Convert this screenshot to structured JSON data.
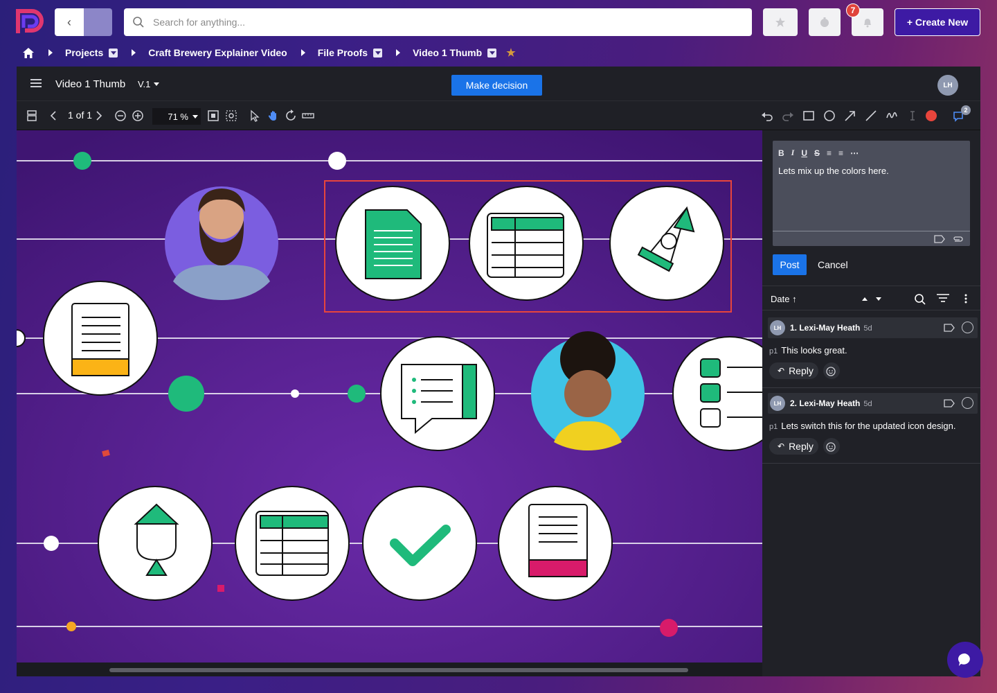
{
  "topbar": {
    "search_placeholder": "Search for anything...",
    "notification_count": "7",
    "create_label": "+ Create New"
  },
  "breadcrumb": {
    "items": [
      "Projects",
      "Craft Brewery Explainer Video",
      "File Proofs",
      "Video 1 Thumb"
    ]
  },
  "header": {
    "title": "Video 1 Thumb",
    "version": "V.1",
    "decision_label": "Make decision",
    "avatar_initials": "LH"
  },
  "toolbar": {
    "page_indicator": "1 of 1",
    "zoom": "71 %",
    "comment_count": "2",
    "annotation_color": "#e8453c"
  },
  "editor": {
    "text": "Lets mix up the colors here.",
    "post_label": "Post",
    "cancel_label": "Cancel"
  },
  "comments_panel": {
    "sort_label": "Date",
    "comments": [
      {
        "initials": "LH",
        "author": "1. Lexi-May Heath",
        "age": "5d",
        "page": "p1",
        "text": "This looks great.",
        "reply_label": "Reply"
      },
      {
        "initials": "LH",
        "author": "2. Lexi-May Heath",
        "age": "5d",
        "page": "p1",
        "text": "Lets switch this for the updated icon design.",
        "reply_label": "Reply"
      }
    ]
  },
  "colors": {
    "brand_purple": "#3d1aa4",
    "primary_blue": "#1a73e8",
    "canvas_purple": "#45187a",
    "icon_green": "#1fba7b"
  }
}
